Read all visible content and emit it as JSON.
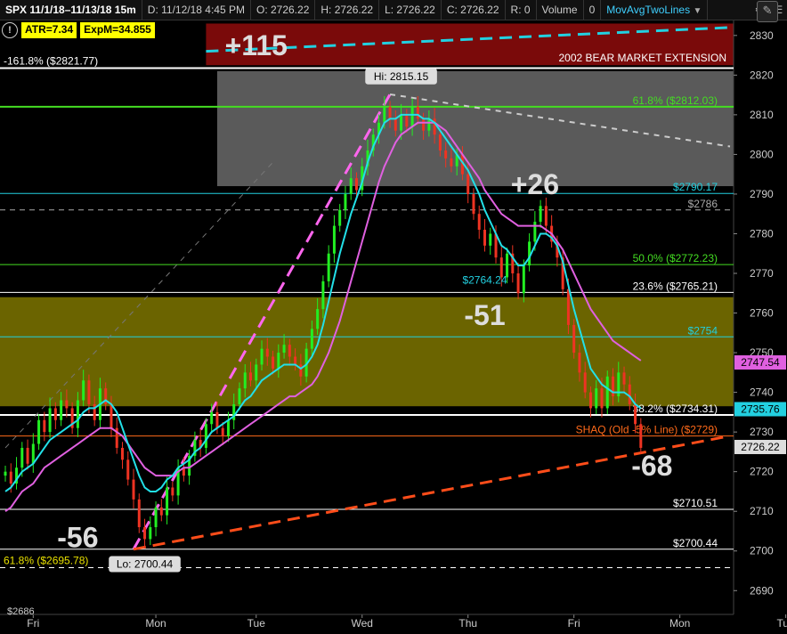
{
  "header": {
    "symbol": "SPX 11/1/18–11/13/18 15m",
    "date": "D: 11/12/18 4:45 PM",
    "open": "O: 2726.22",
    "high": "H: 2726.22",
    "low": "L: 2726.22",
    "close": "C: 2726.22",
    "range": "R: 0",
    "volume": "Volume",
    "volume_value": "0",
    "study": "MovAvgTwoLines",
    "gear_icon": "gear-icon",
    "menu_icon": "hamburger-menu-icon"
  },
  "badges": {
    "atr": "ATR=7.34",
    "expm": "ExpM=34.855",
    "info_icon": "info-icon"
  },
  "colors": {
    "bg": "#000000",
    "up": "#22ee22",
    "down": "#ee3322",
    "ma_fast": "#22e0e8",
    "ma_slow": "#e060e0",
    "fib_green": "#44dd22",
    "zone_red": "#7a0a0a",
    "zone_gray": "#5a5a5a",
    "zone_olive": "#6b6400"
  },
  "chart_data": {
    "type": "candlestick",
    "ylim": [
      2684,
      2834
    ],
    "yticks": [
      2690,
      2700,
      2710,
      2720,
      2730,
      2740,
      2750,
      2760,
      2770,
      2780,
      2790,
      2800,
      2810,
      2820,
      2830
    ],
    "xlabels": [
      "Fri",
      "Mon",
      "Tue",
      "Wed",
      "Thu",
      "Fri",
      "Mon",
      "Tue"
    ],
    "closes": [
      2720,
      2717,
      2721,
      2726,
      2722,
      2727,
      2733,
      2730,
      2736,
      2733,
      2738,
      2736,
      2731,
      2738,
      2743,
      2737,
      2733,
      2741,
      2737,
      2731,
      2726,
      2723,
      2718,
      2713,
      2706,
      2703,
      2706,
      2711,
      2709,
      2716,
      2714,
      2721,
      2719,
      2724,
      2728,
      2726,
      2732,
      2735,
      2731,
      2729,
      2733,
      2737,
      2741,
      2745,
      2743,
      2747,
      2751,
      2749,
      2746,
      2750,
      2752,
      2749,
      2747,
      2744,
      2751,
      2756,
      2761,
      2768,
      2775,
      2782,
      2786,
      2790,
      2794,
      2791,
      2797,
      2801,
      2805,
      2808,
      2812,
      2809,
      2806,
      2810,
      2807,
      2812,
      2809,
      2806,
      2809,
      2805,
      2801,
      2799,
      2797,
      2800,
      2795,
      2790,
      2785,
      2781,
      2777,
      2780,
      2774,
      2769,
      2775,
      2770,
      2765,
      2772,
      2778,
      2783,
      2787,
      2782,
      2778,
      2774,
      2766,
      2757,
      2750,
      2745,
      2740,
      2736,
      2741,
      2736,
      2744,
      2739,
      2745,
      2742,
      2737,
      2732,
      2726
    ],
    "ma_fast": [
      2715,
      2716,
      2718,
      2720,
      2721,
      2722,
      2724,
      2726,
      2728,
      2729,
      2730,
      2731,
      2732,
      2733,
      2735,
      2736,
      2736,
      2737,
      2738,
      2737,
      2735,
      2731,
      2727,
      2723,
      2719,
      2716,
      2715,
      2715,
      2716,
      2718,
      2719,
      2721,
      2722,
      2723,
      2725,
      2726,
      2728,
      2730,
      2731,
      2732,
      2733,
      2734,
      2736,
      2738,
      2739,
      2741,
      2743,
      2744,
      2745,
      2746,
      2747,
      2747,
      2747,
      2746,
      2747,
      2749,
      2752,
      2757,
      2763,
      2769,
      2775,
      2780,
      2785,
      2789,
      2793,
      2798,
      2802,
      2805,
      2808,
      2809,
      2809,
      2810,
      2810,
      2810,
      2810,
      2809,
      2809,
      2808,
      2806,
      2804,
      2802,
      2800,
      2798,
      2796,
      2793,
      2790,
      2786,
      2783,
      2780,
      2777,
      2776,
      2774,
      2772,
      2772,
      2774,
      2777,
      2780,
      2780,
      2779,
      2777,
      2773,
      2767,
      2761,
      2756,
      2751,
      2746,
      2744,
      2742,
      2741,
      2740,
      2740,
      2740,
      2739,
      2737,
      2736
    ],
    "ma_slow": [
      2710,
      2711,
      2713,
      2715,
      2716,
      2717,
      2719,
      2721,
      2722,
      2723,
      2724,
      2725,
      2726,
      2727,
      2728,
      2729,
      2730,
      2731,
      2731,
      2731,
      2730,
      2729,
      2727,
      2725,
      2723,
      2721,
      2720,
      2719,
      2719,
      2719,
      2719,
      2720,
      2721,
      2721,
      2722,
      2723,
      2724,
      2725,
      2726,
      2727,
      2728,
      2729,
      2730,
      2731,
      2732,
      2733,
      2734,
      2735,
      2736,
      2737,
      2738,
      2739,
      2739,
      2740,
      2741,
      2742,
      2744,
      2747,
      2750,
      2754,
      2758,
      2763,
      2768,
      2773,
      2778,
      2783,
      2788,
      2793,
      2797,
      2800,
      2803,
      2805,
      2806,
      2807,
      2808,
      2808,
      2808,
      2808,
      2807,
      2806,
      2804,
      2802,
      2800,
      2798,
      2796,
      2794,
      2791,
      2789,
      2787,
      2785,
      2784,
      2783,
      2782,
      2782,
      2782,
      2782,
      2782,
      2781,
      2780,
      2778,
      2776,
      2773,
      2770,
      2767,
      2764,
      2761,
      2759,
      2757,
      2755,
      2753,
      2752,
      2751,
      2750,
      2749,
      2748
    ],
    "hlines": [
      {
        "price": 2821.77,
        "label": "-161.8% ($2821.77)",
        "color": "#ffffff",
        "label_color": "#ffffff",
        "side": "left",
        "width": 2
      },
      {
        "price": 2812.03,
        "label": "61.8% ($2812.03)",
        "color": "#44dd22",
        "label_color": "#44dd22",
        "side": "right",
        "width": 2
      },
      {
        "price": 2790.17,
        "label": "$2790.17",
        "color": "#22d0e0",
        "label_color": "#22d0e0",
        "side": "right",
        "width": 1
      },
      {
        "price": 2786,
        "label": "$2786",
        "color": "#aaaaaa",
        "label_color": "#aaaaaa",
        "side": "right",
        "width": 1,
        "dash": true
      },
      {
        "price": 2772.23,
        "label": "50.0% ($2772.23)",
        "color": "#44dd22",
        "label_color": "#44dd22",
        "side": "right",
        "width": 1
      },
      {
        "price": 2765.21,
        "label": "23.6% ($2765.21)",
        "color": "#ffffff",
        "label_color": "#ffffff",
        "side": "right",
        "width": 1
      },
      {
        "price": 2754,
        "label": "$2754",
        "color": "#22d0e0",
        "label_color": "#22d0e0",
        "side": "right",
        "width": 1
      },
      {
        "price": 2734.31,
        "label": "38.2% ($2734.31)",
        "color": "#ffffff",
        "label_color": "#ffffff",
        "side": "right",
        "width": 2
      },
      {
        "price": 2729,
        "label": "SHAQ (Old -5% Line)  ($2729)",
        "color": "#ff6a1a",
        "label_color": "#ff6a1a",
        "side": "right",
        "width": 1
      },
      {
        "price": 2710.51,
        "label": "$2710.51",
        "color": "#ffffff",
        "label_color": "#ffffff",
        "side": "right",
        "width": 1
      },
      {
        "price": 2700.44,
        "label": "$2700.44",
        "color": "#ffffff",
        "label_color": "#ffffff",
        "side": "right",
        "width": 1
      },
      {
        "price": 2695.78,
        "label": "61.8% ($2695.78)",
        "color": "#ffffff",
        "label_color": "#e8e000",
        "side": "left",
        "width": 1,
        "dash": true
      }
    ],
    "zones": [
      {
        "from": 2822.5,
        "to": 2833,
        "color": "#7a0a0a",
        "label": "2002 BEAR MARKET EXTENSION"
      },
      {
        "from": 2792,
        "to": 2821,
        "color": "#5a5a5a",
        "label": ""
      },
      {
        "from": 2736.5,
        "to": 2764,
        "color": "#6b6400",
        "label": ""
      }
    ],
    "price_tags": [
      {
        "price": 2747.54,
        "label": "2747.54",
        "bg": "#e060e0"
      },
      {
        "price": 2735.76,
        "label": "2735.76",
        "bg": "#22d0e0"
      },
      {
        "price": 2726.22,
        "label": "2726.22",
        "bg": "#dddddd"
      }
    ],
    "annotations": [
      {
        "text": "+115",
        "i": 45,
        "price": 2825
      },
      {
        "text": "+26",
        "i": 95,
        "price": 2790
      },
      {
        "text": "-51",
        "i": 86,
        "price": 2757
      },
      {
        "text": "-56",
        "i": 13,
        "price": 2701
      },
      {
        "text": "-68",
        "i": 116,
        "price": 2719
      }
    ],
    "callouts": [
      {
        "text": "Hi: 2815.15",
        "i": 71,
        "price": 2819
      },
      {
        "text": "Lo: 2700.44",
        "i": 25,
        "price": 2696
      },
      {
        "text": "$2764.24",
        "i": 86,
        "price": 2766.5
      }
    ],
    "extra_left_label": "$2686",
    "trendlines": [
      {
        "x1i": 23,
        "y1": 2700.44,
        "x2i": 69,
        "y2": 2815.15,
        "color": "#ff66ee",
        "dash": true,
        "width": 3
      },
      {
        "x1i": 23,
        "y1": 2700.44,
        "x2i": 130,
        "y2": 2729,
        "color": "#ff4d1a",
        "dash": true,
        "width": 3
      },
      {
        "x1i": 36,
        "y1": 2826,
        "x2i": 130,
        "y2": 2832,
        "color": "#22d0e0",
        "dash": true,
        "width": 3
      },
      {
        "x1i": 0,
        "y1": 2726,
        "x2i": 48,
        "y2": 2798,
        "color": "#777777",
        "dash": true,
        "width": 1
      },
      {
        "x1i": 69,
        "y1": 2815.15,
        "x2i": 130,
        "y2": 2802,
        "color": "#cccccc",
        "dash": true,
        "width": 2
      }
    ]
  }
}
